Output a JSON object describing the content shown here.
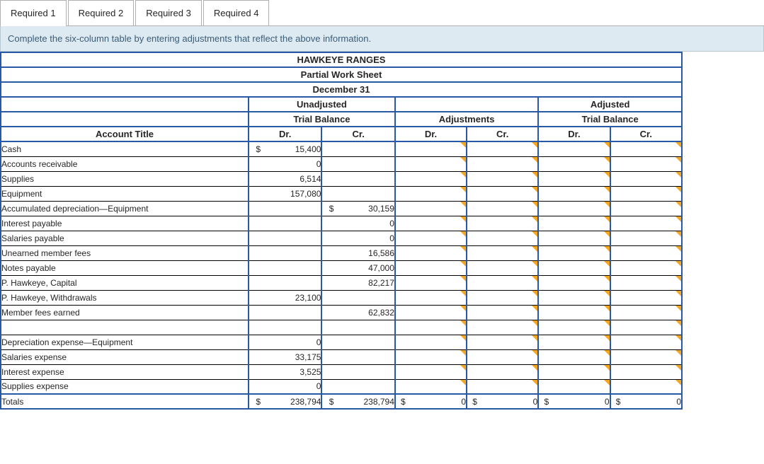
{
  "tabs": [
    "Required 1",
    "Required 2",
    "Required 3",
    "Required 4"
  ],
  "active_tab": 0,
  "instruction": "Complete the six-column table by entering adjustments that reflect the above information.",
  "sheet": {
    "title1": "HAWKEYE RANGES",
    "title2": "Partial Work Sheet",
    "title3": "December 31",
    "group_headers": [
      "Unadjusted",
      "",
      "Adjusted"
    ],
    "group_subheaders": [
      "Trial Balance",
      "Adjustments",
      "Trial Balance"
    ],
    "col_account": "Account Title",
    "dr": "Dr.",
    "cr": "Cr.",
    "rows": [
      {
        "acct": "Cash",
        "u_dr_s": "$",
        "u_dr": "15,400",
        "u_cr_s": "",
        "u_cr": ""
      },
      {
        "acct": "Accounts receivable",
        "u_dr_s": "",
        "u_dr": "0",
        "u_cr_s": "",
        "u_cr": ""
      },
      {
        "acct": "Supplies",
        "u_dr_s": "",
        "u_dr": "6,514",
        "u_cr_s": "",
        "u_cr": ""
      },
      {
        "acct": "Equipment",
        "u_dr_s": "",
        "u_dr": "157,080",
        "u_cr_s": "",
        "u_cr": ""
      },
      {
        "acct": "Accumulated depreciation—Equipment",
        "u_dr_s": "",
        "u_dr": "",
        "u_cr_s": "$",
        "u_cr": "30,159"
      },
      {
        "acct": "Interest payable",
        "u_dr_s": "",
        "u_dr": "",
        "u_cr_s": "",
        "u_cr": "0"
      },
      {
        "acct": "Salaries payable",
        "u_dr_s": "",
        "u_dr": "",
        "u_cr_s": "",
        "u_cr": "0"
      },
      {
        "acct": "Unearned member fees",
        "u_dr_s": "",
        "u_dr": "",
        "u_cr_s": "",
        "u_cr": "16,586"
      },
      {
        "acct": "Notes payable",
        "u_dr_s": "",
        "u_dr": "",
        "u_cr_s": "",
        "u_cr": "47,000"
      },
      {
        "acct": "P. Hawkeye, Capital",
        "u_dr_s": "",
        "u_dr": "",
        "u_cr_s": "",
        "u_cr": "82,217"
      },
      {
        "acct": "P. Hawkeye, Withdrawals",
        "u_dr_s": "",
        "u_dr": "23,100",
        "u_cr_s": "",
        "u_cr": ""
      },
      {
        "acct": "Member fees earned",
        "u_dr_s": "",
        "u_dr": "",
        "u_cr_s": "",
        "u_cr": "62,832"
      },
      {
        "acct": "",
        "blank": true
      },
      {
        "acct": "Depreciation expense—Equipment",
        "u_dr_s": "",
        "u_dr": "0",
        "u_cr_s": "",
        "u_cr": ""
      },
      {
        "acct": "Salaries expense",
        "u_dr_s": "",
        "u_dr": "33,175",
        "u_cr_s": "",
        "u_cr": ""
      },
      {
        "acct": "Interest expense",
        "u_dr_s": "",
        "u_dr": "3,525",
        "u_cr_s": "",
        "u_cr": ""
      },
      {
        "acct": "Supplies expense",
        "u_dr_s": "",
        "u_dr": "0",
        "u_cr_s": "",
        "u_cr": ""
      }
    ],
    "totals": {
      "label": "Totals",
      "u_dr_s": "$",
      "u_dr": "238,794",
      "u_cr_s": "$",
      "u_cr": "238,794",
      "adj_dr_s": "$",
      "adj_dr": "0",
      "adj_cr_s": "$",
      "adj_cr": "0",
      "a_dr_s": "$",
      "a_dr": "0",
      "a_cr_s": "$",
      "a_cr": "0"
    }
  }
}
